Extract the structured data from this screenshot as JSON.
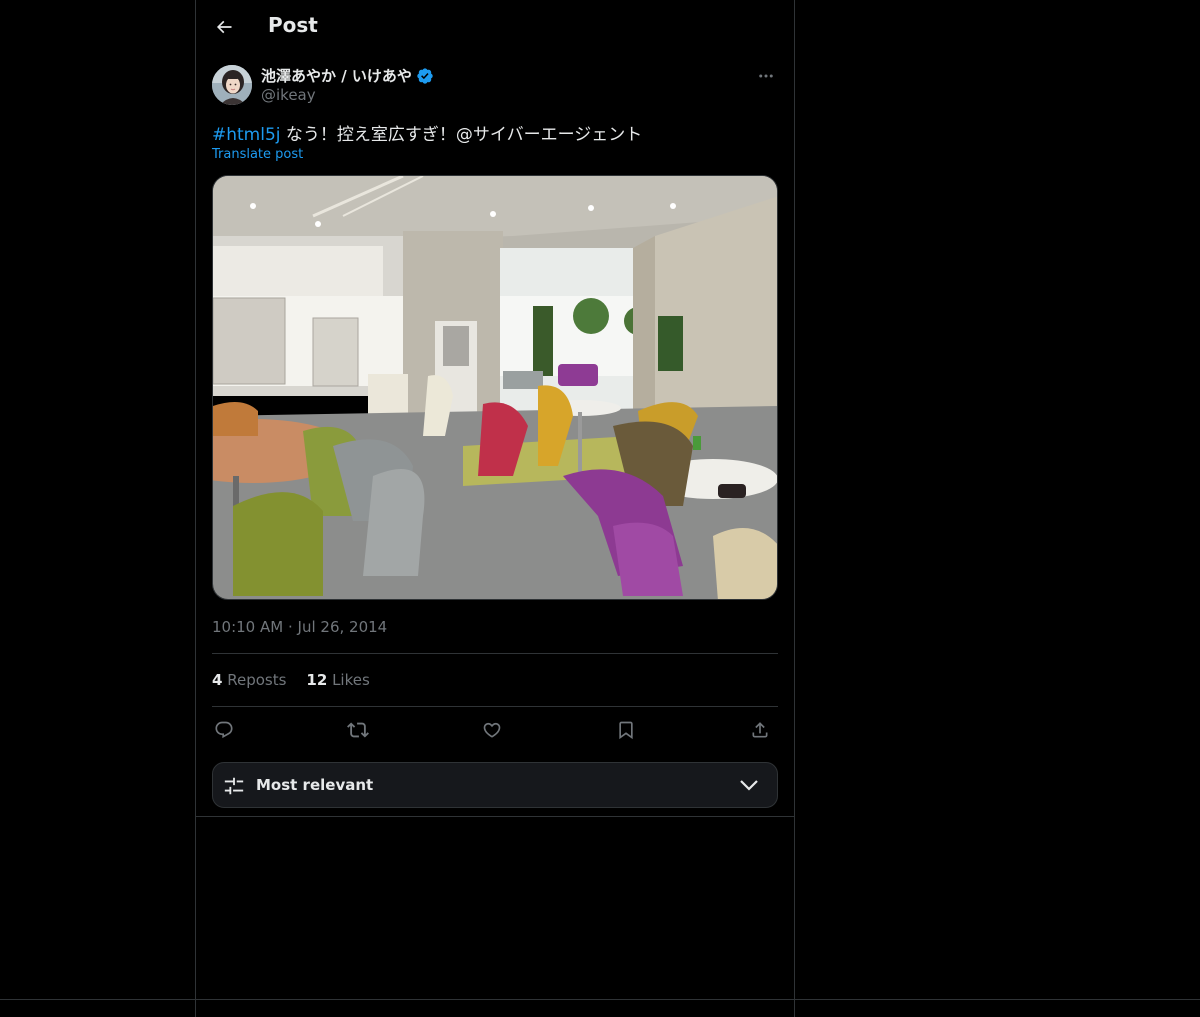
{
  "header": {
    "title": "Post",
    "back_icon": "back-arrow-icon"
  },
  "author": {
    "name": "池澤あやか / いけあや",
    "handle": "@ikeay",
    "verified": true,
    "verified_color": "#1d9bf0"
  },
  "post": {
    "hashtag": "#html5j",
    "text": " なう！控え室広すぎ！@サイバーエージェント",
    "translate_label": "Translate post",
    "time": "10:10 AM",
    "separator": "·",
    "date": "Jul 26, 2014",
    "media_description_icon": "photo-office-lounge"
  },
  "stats": {
    "reposts_count": "4",
    "reposts_label": "Reposts",
    "likes_count": "12",
    "likes_label": "Likes"
  },
  "actions": {
    "icons": [
      "reply-icon",
      "repost-icon",
      "like-icon",
      "bookmark-icon",
      "share-icon"
    ]
  },
  "replies_sort": {
    "label": "Most relevant",
    "icon": "sliders-icon",
    "chevron": "chevron-down-icon"
  },
  "colors": {
    "background": "#000000",
    "border": "#2f3336",
    "text_primary": "#e7e9ea",
    "text_secondary": "#71767b",
    "accent": "#1d9bf0"
  }
}
